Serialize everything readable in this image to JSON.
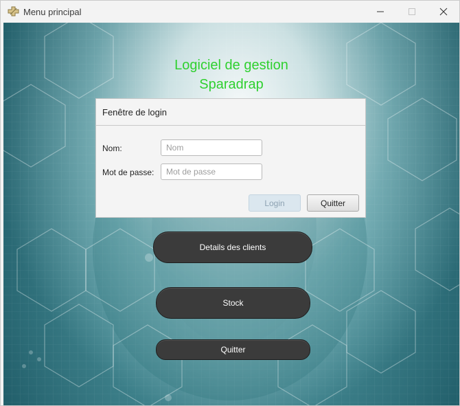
{
  "window": {
    "title": "Menu principal",
    "icon": "pharmacy-cross-icon"
  },
  "app": {
    "title_line1": "Logiciel de gestion",
    "title_line2": "Sparadrap",
    "title_color": "#2fd02f"
  },
  "login": {
    "header": "Fenêtre de login",
    "name_label": "Nom:",
    "name_placeholder": "Nom",
    "password_label": "Mot de passe:",
    "password_placeholder": "Mot de passe",
    "login_button": "Login",
    "quit_button": "Quitter"
  },
  "menu": {
    "details_button": "Details des clients",
    "stock_button": "Stock",
    "quit_button": "Quitter"
  }
}
